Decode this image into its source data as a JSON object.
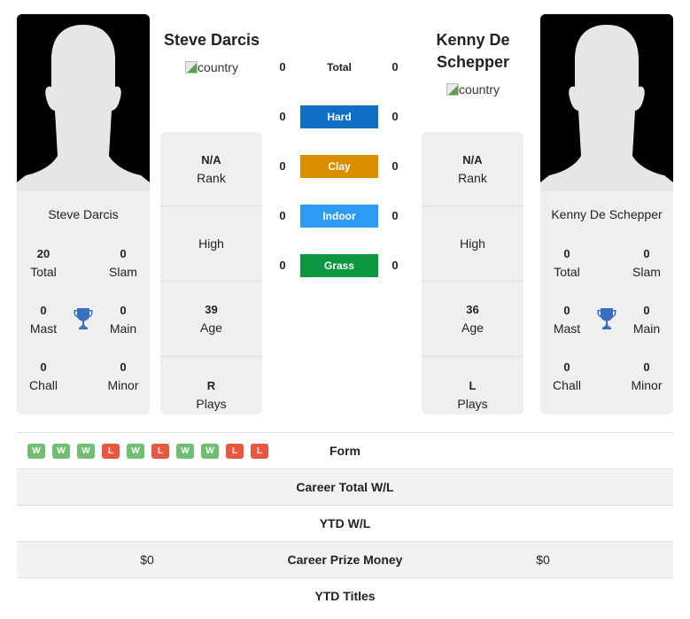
{
  "player1": {
    "name": "Steve Darcis",
    "flag_alt": "country",
    "titles": {
      "total": {
        "value": "20",
        "label": "Total"
      },
      "slam": {
        "value": "0",
        "label": "Slam"
      },
      "mast": {
        "value": "0",
        "label": "Mast"
      },
      "main": {
        "value": "0",
        "label": "Main"
      },
      "chall": {
        "value": "0",
        "label": "Chall"
      },
      "minor": {
        "value": "0",
        "label": "Minor"
      }
    },
    "rank": {
      "value": "N/A",
      "label": "Rank"
    },
    "high": {
      "label": "High"
    },
    "age": {
      "value": "39",
      "label": "Age"
    },
    "plays": {
      "value": "R",
      "label": "Plays"
    }
  },
  "player2": {
    "name": "Kenny De Schepper",
    "flag_alt": "country",
    "titles": {
      "total": {
        "value": "0",
        "label": "Total"
      },
      "slam": {
        "value": "0",
        "label": "Slam"
      },
      "mast": {
        "value": "0",
        "label": "Mast"
      },
      "main": {
        "value": "0",
        "label": "Main"
      },
      "chall": {
        "value": "0",
        "label": "Chall"
      },
      "minor": {
        "value": "0",
        "label": "Minor"
      }
    },
    "rank": {
      "value": "N/A",
      "label": "Rank"
    },
    "high": {
      "label": "High"
    },
    "age": {
      "value": "36",
      "label": "Age"
    },
    "plays": {
      "value": "L",
      "label": "Plays"
    }
  },
  "h2h": [
    {
      "label": "Total",
      "p1": "0",
      "p2": "0",
      "color": ""
    },
    {
      "label": "Hard",
      "p1": "0",
      "p2": "0",
      "color": "#0f6fc6"
    },
    {
      "label": "Clay",
      "p1": "0",
      "p2": "0",
      "color": "#dd8e00"
    },
    {
      "label": "Indoor",
      "p1": "0",
      "p2": "0",
      "color": "#2b9cf2"
    },
    {
      "label": "Grass",
      "p1": "0",
      "p2": "0",
      "color": "#0d9640"
    }
  ],
  "form": {
    "label": "Form",
    "results": [
      "W",
      "W",
      "W",
      "L",
      "W",
      "L",
      "W",
      "W",
      "L",
      "L"
    ],
    "colors": {
      "W": "#6fbf73",
      "L": "#e9573f"
    }
  },
  "stats": [
    {
      "label": "Career Total W/L",
      "p1": "",
      "p2": ""
    },
    {
      "label": "YTD W/L",
      "p1": "",
      "p2": ""
    },
    {
      "label": "Career Prize Money",
      "p1": "$0",
      "p2": "$0"
    },
    {
      "label": "YTD Titles",
      "p1": "",
      "p2": ""
    }
  ],
  "colors": {
    "card_bg": "#efefef",
    "trophy": "#3a6fbf"
  }
}
